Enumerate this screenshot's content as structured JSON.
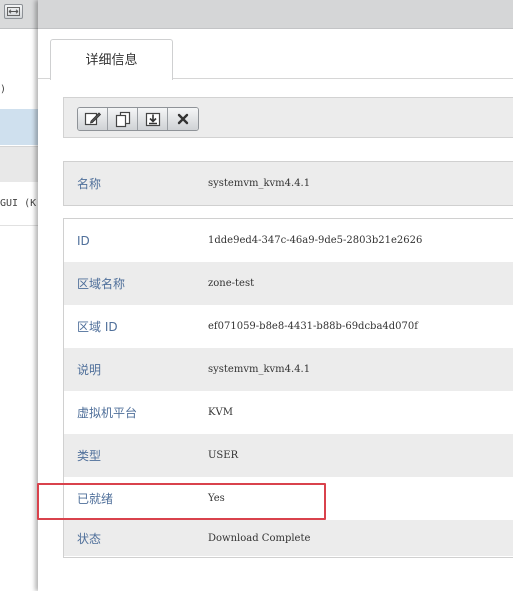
{
  "left_panel": {
    "rows": [
      ")",
      "",
      "",
      "GUI (K"
    ]
  },
  "tab": {
    "label": "详细信息"
  },
  "toolbar": {
    "buttons": [
      {
        "name": "edit",
        "icon": "edit-icon"
      },
      {
        "name": "copy",
        "icon": "copy-icon"
      },
      {
        "name": "download",
        "icon": "download-icon"
      },
      {
        "name": "delete",
        "icon": "close-icon"
      }
    ]
  },
  "details": {
    "name_row": {
      "label": "名称",
      "value": "systemvm_kvm4.4.1"
    },
    "rows": [
      {
        "label": "ID",
        "value": "1dde9ed4-347c-46a9-9de5-2803b21e2626"
      },
      {
        "label": "区域名称",
        "value": "zone-test"
      },
      {
        "label": "区域 ID",
        "value": "ef071059-b8e8-4431-b88b-69dcba4d070f"
      },
      {
        "label": "说明",
        "value": "systemvm_kvm4.4.1"
      },
      {
        "label": "虚拟机平台",
        "value": "KVM"
      },
      {
        "label": "类型",
        "value": "USER"
      },
      {
        "label": "已就绪",
        "value": "Yes"
      },
      {
        "label": "状态",
        "value": "Download Complete"
      }
    ]
  },
  "colors": {
    "highlight_border": "#d9424c",
    "label_text": "#4f6f9a",
    "selected_row": "#cfe0ee"
  }
}
